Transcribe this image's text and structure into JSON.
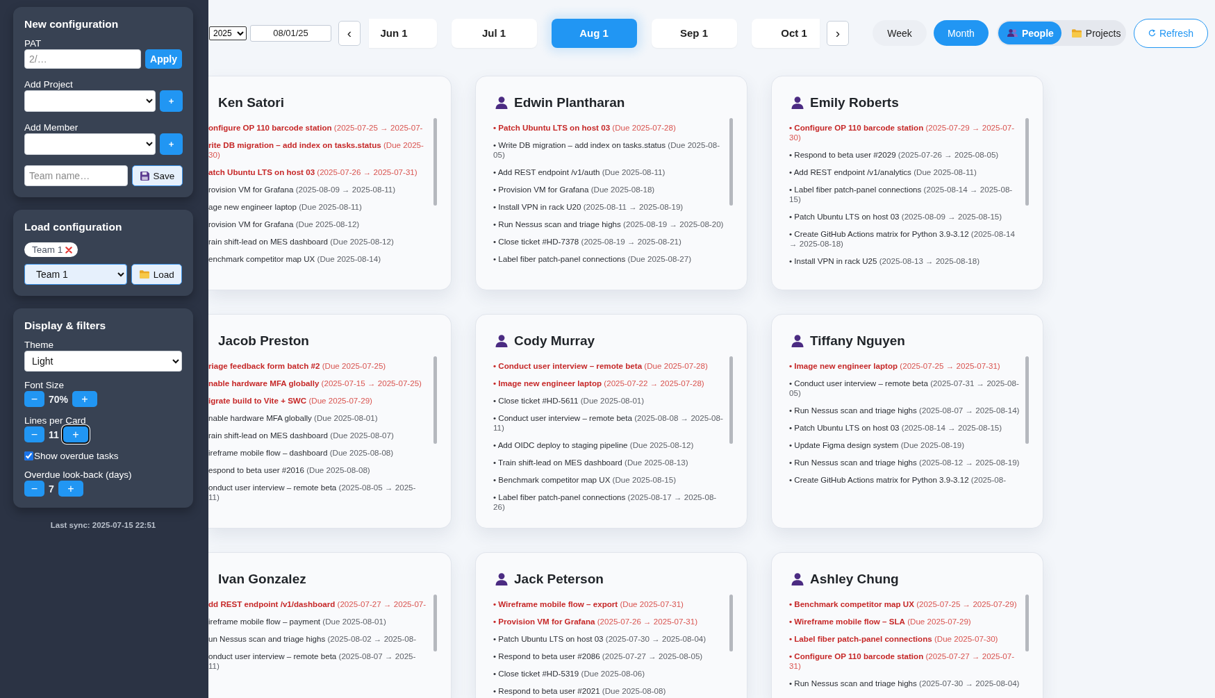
{
  "sidebar": {
    "new_configuration": {
      "title": "New configuration",
      "rows": [
        {
          "kind": "input",
          "label": "PAT",
          "placeholder": "2/…",
          "button": "Apply"
        },
        {
          "kind": "select",
          "label": "Add Project",
          "button": "+"
        },
        {
          "kind": "select",
          "label": "Add Member",
          "button": "+"
        },
        {
          "kind": "save",
          "placeholder": "Team name…",
          "button": "Save"
        }
      ]
    },
    "load_configuration": {
      "title": "Load configuration",
      "chips": [
        {
          "label": "Team 1"
        }
      ],
      "select_value": "Team 1",
      "button": "Load"
    },
    "display_filters": {
      "title": "Display & filters",
      "controls": [
        {
          "kind": "select",
          "label": "Theme",
          "value": "Light"
        },
        {
          "kind": "stepper",
          "label": "Font Size",
          "decrement": "−",
          "value": "70%",
          "increment": "+",
          "increment_focused": false
        },
        {
          "kind": "stepper",
          "label": "Lines per Card",
          "decrement": "−",
          "value": "11",
          "increment": "+",
          "increment_focused": true
        },
        {
          "kind": "checkbox",
          "label": "Show overdue tasks",
          "checked": true
        },
        {
          "kind": "stepper",
          "label": "Overdue look-back (days)",
          "decrement": "−",
          "value": "7",
          "increment": "+",
          "increment_focused": false
        }
      ]
    },
    "last_sync": "Last sync: 2025-07-15 22:51"
  },
  "toolbar": {
    "year": "2025",
    "date": "08/01/25",
    "prev": "‹",
    "months": [
      {
        "label": "Jun 1",
        "selected": false
      },
      {
        "label": "Jul 1",
        "selected": false
      },
      {
        "label": "Aug 1",
        "selected": true
      },
      {
        "label": "Sep 1",
        "selected": false
      },
      {
        "label": "Oct 1",
        "selected": false
      }
    ],
    "next": "›",
    "views": [
      {
        "label": "Week",
        "selected": false
      },
      {
        "label": "Month",
        "selected": true
      }
    ],
    "modes": [
      {
        "label": "People",
        "selected": true
      },
      {
        "label": "Projects",
        "selected": false
      }
    ],
    "refresh": "Refresh"
  },
  "cards": [
    {
      "name": "Ken Satori",
      "tasks": [
        {
          "title": "onfigure OP 110 barcode station",
          "dates": "(2025-07-25 → 2025-07-",
          "overdue": true
        },
        {
          "title": "rite DB migration – add index on tasks.status",
          "dates": "(Due 2025-",
          "dates_wrap": "30)",
          "overdue": true
        },
        {
          "title": "atch Ubuntu LTS on host 03",
          "dates": "(2025-07-26 → 2025-07-31)",
          "overdue": true
        },
        {
          "title": "rovision VM for Grafana",
          "dates": "(2025-08-09 → 2025-08-11)",
          "overdue": false
        },
        {
          "title": "age new engineer laptop",
          "dates": "(Due 2025-08-11)",
          "overdue": false
        },
        {
          "title": "rovision VM for Grafana",
          "dates": "(Due 2025-08-12)",
          "overdue": false
        },
        {
          "title": "rain shift-lead on MES dashboard",
          "dates": "(Due 2025-08-12)",
          "overdue": false
        },
        {
          "title": "enchmark competitor map UX",
          "dates": "(Due 2025-08-14)",
          "overdue": false
        }
      ]
    },
    {
      "name": "Edwin Plantharan",
      "tasks": [
        {
          "title": "• Patch Ubuntu LTS on host 03",
          "dates": "(Due 2025-07-28)",
          "overdue": true
        },
        {
          "title": "• Write DB migration – add index on tasks.status",
          "dates": "(Due 2025-08-05)",
          "overdue": false
        },
        {
          "title": "• Add REST endpoint /v1/auth",
          "dates": "(Due 2025-08-11)",
          "overdue": false
        },
        {
          "title": "• Provision VM for Grafana",
          "dates": "(Due 2025-08-18)",
          "overdue": false
        },
        {
          "title": "• Install VPN in rack U20",
          "dates": "(2025-08-11 → 2025-08-19)",
          "overdue": false
        },
        {
          "title": "• Run Nessus scan and triage highs",
          "dates": "(2025-08-19 → 2025-08-20)",
          "overdue": false
        },
        {
          "title": "• Close ticket #HD-7378",
          "dates": "(2025-08-19 → 2025-08-21)",
          "overdue": false
        },
        {
          "title": "• Label fiber patch-panel connections",
          "dates": "(Due 2025-08-27)",
          "overdue": false
        }
      ]
    },
    {
      "name": "Emily Roberts",
      "tasks": [
        {
          "title": "• Configure OP 110 barcode station",
          "dates": "(2025-07-29 → 2025-07-30)",
          "overdue": true
        },
        {
          "title": "• Respond to beta user #2029",
          "dates": "(2025-07-26 → 2025-08-05)",
          "overdue": false
        },
        {
          "title": "• Add REST endpoint /v1/analytics",
          "dates": "(Due 2025-08-11)",
          "overdue": false
        },
        {
          "title": "• Label fiber patch-panel connections",
          "dates": "(2025-08-14 → 2025-08-15)",
          "overdue": false
        },
        {
          "title": "• Patch Ubuntu LTS on host 03",
          "dates": "(2025-08-09 → 2025-08-15)",
          "overdue": false
        },
        {
          "title": "• Create GitHub Actions matrix for Python 3.9-3.12",
          "dates": "(2025-08-14 → 2025-08-18)",
          "overdue": false
        },
        {
          "title": "• Install VPN in rack U25",
          "dates": "(2025-08-13 → 2025-08-18)",
          "overdue": false
        }
      ]
    },
    {
      "name": "Jacob Preston",
      "tasks": [
        {
          "title": "riage feedback form batch #2",
          "dates": "(Due 2025-07-25)",
          "overdue": true
        },
        {
          "title": "nable hardware MFA globally",
          "dates": "(2025-07-15 → 2025-07-25)",
          "overdue": true
        },
        {
          "title": "igrate build to Vite + SWC",
          "dates": "(Due 2025-07-29)",
          "overdue": true
        },
        {
          "title": "nable hardware MFA globally",
          "dates": "(Due 2025-08-01)",
          "overdue": false
        },
        {
          "title": "rain shift-lead on MES dashboard",
          "dates": "(Due 2025-08-07)",
          "overdue": false
        },
        {
          "title": "ireframe mobile flow – dashboard",
          "dates": "(Due 2025-08-08)",
          "overdue": false
        },
        {
          "title": "espond to beta user #2016",
          "dates": "(Due 2025-08-08)",
          "overdue": false
        },
        {
          "title": "onduct user interview – remote beta",
          "dates": "(2025-08-05 → 2025-",
          "dates_wrap": "11)",
          "overdue": false
        }
      ]
    },
    {
      "name": "Cody Murray",
      "tasks": [
        {
          "title": "• Conduct user interview – remote beta",
          "dates": "(Due 2025-07-28)",
          "overdue": true
        },
        {
          "title": "• Image new engineer laptop",
          "dates": "(2025-07-22 → 2025-07-28)",
          "overdue": true
        },
        {
          "title": "• Close ticket #HD-5611",
          "dates": "(Due 2025-08-01)",
          "overdue": false
        },
        {
          "title": "• Conduct user interview – remote beta",
          "dates": "(2025-08-08 → 2025-08-11)",
          "overdue": false
        },
        {
          "title": "• Add OIDC deploy to staging pipeline",
          "dates": "(Due 2025-08-12)",
          "overdue": false
        },
        {
          "title": "• Train shift-lead on MES dashboard",
          "dates": "(Due 2025-08-13)",
          "overdue": false
        },
        {
          "title": "• Benchmark competitor map UX",
          "dates": "(Due 2025-08-15)",
          "overdue": false
        },
        {
          "title": "• Label fiber patch-panel connections",
          "dates": "(2025-08-17 → 2025-08-26)",
          "overdue": false
        }
      ]
    },
    {
      "name": "Tiffany Nguyen",
      "tasks": [
        {
          "title": "• Image new engineer laptop",
          "dates": "(2025-07-25 → 2025-07-31)",
          "overdue": true
        },
        {
          "title": "• Conduct user interview – remote beta",
          "dates": "(2025-07-31 → 2025-08-05)",
          "overdue": false
        },
        {
          "title": "• Run Nessus scan and triage highs",
          "dates": "(2025-08-07 → 2025-08-14)",
          "overdue": false
        },
        {
          "title": "• Patch Ubuntu LTS on host 03",
          "dates": "(2025-08-14 → 2025-08-15)",
          "overdue": false
        },
        {
          "title": "• Update Figma design system",
          "dates": "(Due 2025-08-19)",
          "overdue": false
        },
        {
          "title": "• Run Nessus scan and triage highs",
          "dates": "(2025-08-12 → 2025-08-19)",
          "overdue": false
        },
        {
          "title": "• Create GitHub Actions matrix for Python 3.9-3.12",
          "dates": "(2025-08-",
          "overdue": false
        }
      ]
    },
    {
      "name": "Ivan Gonzalez",
      "tasks": [
        {
          "title": "dd REST endpoint /v1/dashboard",
          "dates": "(2025-07-27 → 2025-07-",
          "overdue": true
        },
        {
          "title": "ireframe mobile flow – payment",
          "dates": "(Due 2025-08-01)",
          "overdue": false
        },
        {
          "title": "un Nessus scan and triage highs",
          "dates": "(2025-08-02 → 2025-08-",
          "overdue": false
        },
        {
          "title": "onduct user interview – remote beta",
          "dates": "(2025-08-07 → 2025-",
          "dates_wrap": "11)",
          "overdue": false
        }
      ]
    },
    {
      "name": "Jack Peterson",
      "tasks": [
        {
          "title": "• Wireframe mobile flow – export",
          "dates": "(Due 2025-07-31)",
          "overdue": true
        },
        {
          "title": "• Provision VM for Grafana",
          "dates": "(2025-07-26 → 2025-07-31)",
          "overdue": true
        },
        {
          "title": "• Patch Ubuntu LTS on host 03",
          "dates": "(2025-07-30 → 2025-08-04)",
          "overdue": false
        },
        {
          "title": "• Respond to beta user #2086",
          "dates": "(2025-07-27 → 2025-08-05)",
          "overdue": false
        },
        {
          "title": "• Close ticket #HD-5319",
          "dates": "(Due 2025-08-06)",
          "overdue": false
        },
        {
          "title": "• Respond to beta user #2021",
          "dates": "(Due 2025-08-08)",
          "overdue": false
        }
      ]
    },
    {
      "name": "Ashley Chung",
      "tasks": [
        {
          "title": "• Benchmark competitor map UX",
          "dates": "(2025-07-25 → 2025-07-29)",
          "overdue": true
        },
        {
          "title": "• Wireframe mobile flow – SLA",
          "dates": "(Due 2025-07-29)",
          "overdue": true
        },
        {
          "title": "• Label fiber patch-panel connections",
          "dates": "(Due 2025-07-30)",
          "overdue": true
        },
        {
          "title": "• Configure OP 110 barcode station",
          "dates": "(2025-07-27 → 2025-07-31)",
          "overdue": true
        },
        {
          "title": "• Run Nessus scan and triage highs",
          "dates": "(2025-07-30 → 2025-08-04)",
          "overdue": false
        }
      ]
    }
  ]
}
